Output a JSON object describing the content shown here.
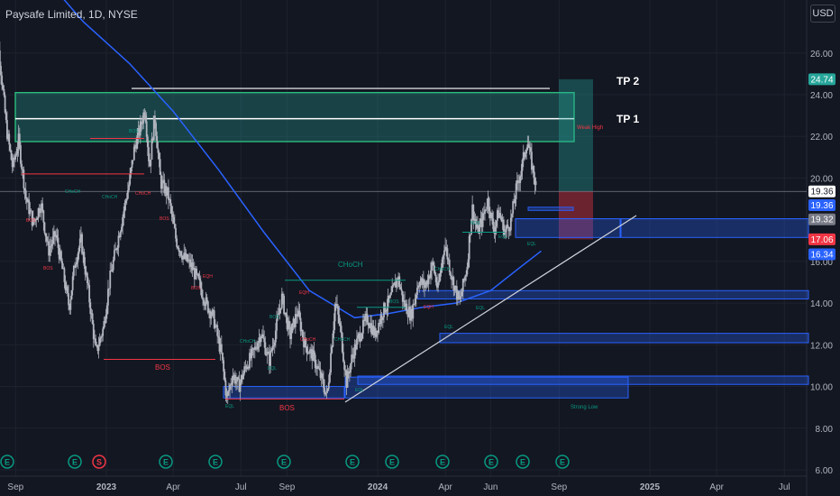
{
  "header": {
    "title": "Paysafe Limited, 1D, NYSE",
    "currency_button": "USD"
  },
  "colors": {
    "background": "#131722",
    "grid": "#1e222d",
    "candle": "#b2b5be",
    "moving_average": "#2962ff",
    "bull_structure": "#089981",
    "bear_structure": "#f23645",
    "target_zone": "#26a69a",
    "stop_zone": "#f23645",
    "demand_zone": "#2962ff"
  },
  "chart_data": {
    "type": "candlestick",
    "title": "Paysafe Limited, 1D, NYSE",
    "ylim": [
      5.7,
      28.2
    ],
    "y_ticks": [
      "6.00",
      "8.00",
      "10.00",
      "12.00",
      "14.00",
      "16.00",
      "18.00",
      "20.00",
      "22.00",
      "24.00",
      "26.00"
    ],
    "x_ticks": [
      "Sep",
      "2023",
      "Apr",
      "Jul",
      "Sep",
      "2024",
      "Apr",
      "Jun",
      "Sep",
      "2025",
      "Apr",
      "Jul"
    ],
    "price_path": [
      [
        "2022-08-01",
        27.2
      ],
      [
        "2022-08-10",
        26.0
      ],
      [
        "2022-08-20",
        22.3
      ],
      [
        "2022-08-28",
        20.5
      ],
      [
        "2022-09-05",
        21.8
      ],
      [
        "2022-09-15",
        19.0
      ],
      [
        "2022-09-25",
        17.8
      ],
      [
        "2022-10-05",
        18.8
      ],
      [
        "2022-10-15",
        16.5
      ],
      [
        "2022-10-25",
        17.3
      ],
      [
        "2022-11-05",
        15.2
      ],
      [
        "2022-11-12",
        13.8
      ],
      [
        "2022-11-20",
        16.0
      ],
      [
        "2022-11-28",
        17.0
      ],
      [
        "2022-12-08",
        14.5
      ],
      [
        "2022-12-18",
        11.6
      ],
      [
        "2022-12-28",
        12.8
      ],
      [
        "2023-01-05",
        15.0
      ],
      [
        "2023-01-15",
        16.8
      ],
      [
        "2023-01-22",
        18.0
      ],
      [
        "2023-02-01",
        19.8
      ],
      [
        "2023-02-08",
        21.5
      ],
      [
        "2023-02-15",
        22.3
      ],
      [
        "2023-02-22",
        23.4
      ],
      [
        "2023-02-28",
        20.5
      ],
      [
        "2023-03-07",
        23.0
      ],
      [
        "2023-03-15",
        19.8
      ],
      [
        "2023-03-25",
        19.2
      ],
      [
        "2023-04-05",
        17.0
      ],
      [
        "2023-04-15",
        16.2
      ],
      [
        "2023-04-25",
        15.8
      ],
      [
        "2023-05-05",
        15.0
      ],
      [
        "2023-05-15",
        14.0
      ],
      [
        "2023-05-25",
        13.3
      ],
      [
        "2023-06-05",
        11.5
      ],
      [
        "2023-06-12",
        9.4
      ],
      [
        "2023-06-20",
        10.6
      ],
      [
        "2023-06-28",
        10.0
      ],
      [
        "2023-07-08",
        11.0
      ],
      [
        "2023-07-18",
        11.6
      ],
      [
        "2023-07-28",
        12.6
      ],
      [
        "2023-08-08",
        11.2
      ],
      [
        "2023-08-18",
        12.9
      ],
      [
        "2023-08-25",
        14.3
      ],
      [
        "2023-09-05",
        12.4
      ],
      [
        "2023-09-15",
        13.6
      ],
      [
        "2023-09-25",
        12.0
      ],
      [
        "2023-10-05",
        11.5
      ],
      [
        "2023-10-15",
        10.6
      ],
      [
        "2023-10-25",
        9.5
      ],
      [
        "2023-11-05",
        14.1
      ],
      [
        "2023-11-12",
        12.7
      ],
      [
        "2023-11-20",
        10.2
      ],
      [
        "2023-11-28",
        11.5
      ],
      [
        "2023-12-08",
        12.5
      ],
      [
        "2023-12-18",
        13.3
      ],
      [
        "2023-12-28",
        12.5
      ],
      [
        "2024-01-08",
        13.6
      ],
      [
        "2024-01-18",
        14.2
      ],
      [
        "2024-01-28",
        15.3
      ],
      [
        "2024-02-05",
        14.0
      ],
      [
        "2024-02-15",
        13.4
      ],
      [
        "2024-02-25",
        15.1
      ],
      [
        "2024-03-05",
        14.8
      ],
      [
        "2024-03-15",
        15.9
      ],
      [
        "2024-03-22",
        14.6
      ],
      [
        "2024-03-31",
        16.9
      ],
      [
        "2024-04-10",
        15.2
      ],
      [
        "2024-04-20",
        14.0
      ],
      [
        "2024-04-30",
        15.7
      ],
      [
        "2024-05-07",
        18.6
      ],
      [
        "2024-05-14",
        17.4
      ],
      [
        "2024-05-21",
        18.0
      ],
      [
        "2024-05-28",
        19.0
      ],
      [
        "2024-06-05",
        17.5
      ],
      [
        "2024-06-12",
        18.4
      ],
      [
        "2024-06-20",
        17.4
      ],
      [
        "2024-06-28",
        17.9
      ],
      [
        "2024-07-05",
        19.4
      ],
      [
        "2024-07-12",
        20.4
      ],
      [
        "2024-07-20",
        21.8
      ],
      [
        "2024-07-26",
        20.7
      ],
      [
        "2024-08-02",
        19.4
      ]
    ],
    "moving_average_path": [
      [
        "2022-08-20",
        32.0
      ],
      [
        "2022-10-01",
        30.0
      ],
      [
        "2022-12-01",
        27.5
      ],
      [
        "2023-02-01",
        25.5
      ],
      [
        "2023-04-01",
        23.2
      ],
      [
        "2023-06-01",
        20.4
      ],
      [
        "2023-08-01",
        17.4
      ],
      [
        "2023-10-01",
        14.6
      ],
      [
        "2023-12-01",
        13.3
      ],
      [
        "2024-01-15",
        13.5
      ],
      [
        "2024-03-01",
        13.8
      ],
      [
        "2024-04-15",
        14.0
      ],
      [
        "2024-06-01",
        14.6
      ],
      [
        "2024-07-10",
        15.7
      ],
      [
        "2024-08-08",
        16.5
      ]
    ],
    "price_labels": [
      {
        "text": "24.74",
        "value": 24.74,
        "bg": "#26a69a"
      },
      {
        "text": "19.36",
        "value": 19.36,
        "bg": "#ffffff",
        "fg": "#131722"
      },
      {
        "text": "19.36",
        "value": 18.7,
        "bg": "#2962ff"
      },
      {
        "text": "19.32",
        "value": 18.02,
        "bg": "#787b86"
      },
      {
        "text": "17.06",
        "value": 17.06,
        "bg": "#f23645"
      },
      {
        "text": "16.34",
        "value": 16.34,
        "bg": "#2962ff"
      }
    ],
    "annotations": {
      "tp2": "TP 2",
      "tp1": "TP 1",
      "bos": "BOS",
      "choch": "CHoCH",
      "eql": "EQL",
      "eqh": "EQH",
      "strong_low": "Strong Low",
      "weak_high": "Weak High"
    }
  },
  "events": [
    "E",
    "E",
    "S",
    "E",
    "E",
    "E",
    "E",
    "E",
    "E",
    "E",
    "E",
    "E"
  ]
}
